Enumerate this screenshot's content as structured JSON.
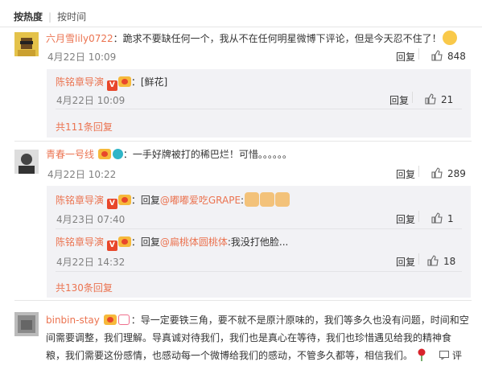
{
  "sort": {
    "active": "按热度",
    "other": "按时间"
  },
  "actions": {
    "reply": "回复",
    "comment_cut": "评"
  },
  "comments": [
    {
      "user": "六月雪lily0722",
      "text": "：跪求不要缺任何一个，我从不在任何明星微博下评论，但是今天忍不住了！",
      "time": "4月22日 10:09",
      "likes": "848",
      "replies": [
        {
          "user": "陈铭章导演",
          "text": "：[鲜花]",
          "time": "4月22日 10:09",
          "likes": "21"
        }
      ],
      "more": "共111条回复"
    },
    {
      "user": "青春一号线",
      "text": "：一手好牌被打的稀巴烂！可惜。。。。。。",
      "time": "4月22日 10:22",
      "likes": "289",
      "replies": [
        {
          "user": "陈铭章导演",
          "prefix": "：回复",
          "mention": "@嘟嘟爱吃GRAPE",
          "text": ":",
          "time": "4月23日 07:40",
          "likes": "1"
        },
        {
          "user": "陈铭章导演",
          "prefix": "：回复",
          "mention": "@扁桃体圆桃体",
          "text": ":我没打他脸...",
          "time": "4月22日 14:32",
          "likes": "18"
        }
      ],
      "more": "共130条回复"
    },
    {
      "user": "binbin-stay",
      "text_lines": [
        "：导一定要铁三角，要不就不是原汁原味的，我们等多久也没有问题，时间和空",
        "间需要调整，我们理解。导真诚对待我们，我们也是真心在等待，我们也珍惜遇见给我的精神食",
        "粮，我们需要这份感情，也感动每一个微博给我们的感动，不管多久都等，相信我们。"
      ]
    }
  ]
}
